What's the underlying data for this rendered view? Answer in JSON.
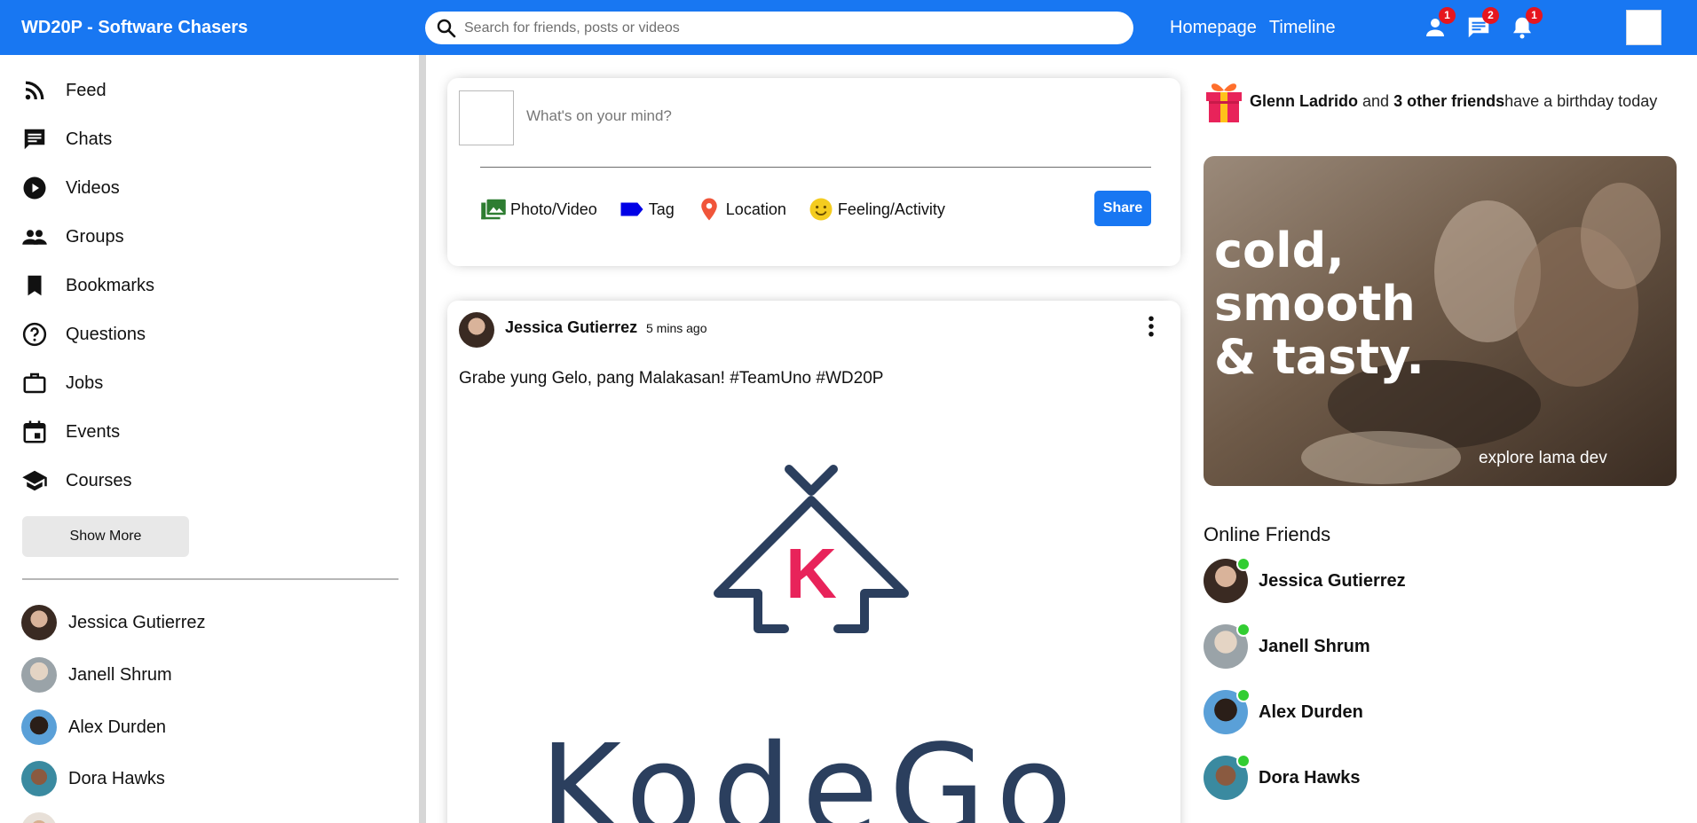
{
  "topbar": {
    "logo": "WD20P - Software Chasers",
    "search_placeholder": "Search for friends, posts or videos",
    "links": [
      "Homepage",
      "Timeline"
    ],
    "badges": {
      "friend_requests": "1",
      "messages": "2",
      "notifications": "1"
    },
    "accent_color": "#1877f2"
  },
  "sidebar": {
    "items": [
      {
        "label": "Feed",
        "icon": "rss-feed-icon"
      },
      {
        "label": "Chats",
        "icon": "chat-icon"
      },
      {
        "label": "Videos",
        "icon": "play-circle-icon"
      },
      {
        "label": "Groups",
        "icon": "group-icon"
      },
      {
        "label": "Bookmarks",
        "icon": "bookmark-icon"
      },
      {
        "label": "Questions",
        "icon": "help-outline-icon"
      },
      {
        "label": "Jobs",
        "icon": "work-outline-icon"
      },
      {
        "label": "Events",
        "icon": "event-icon"
      },
      {
        "label": "Courses",
        "icon": "school-icon"
      }
    ],
    "show_more": "Show More",
    "friends": [
      "Jessica Gutierrez",
      "Janell Shrum",
      "Alex Durden",
      "Dora Hawks"
    ]
  },
  "share": {
    "placeholder": "What's on your mind?",
    "options": [
      {
        "label": "Photo/Video",
        "icon": "perm-media-icon"
      },
      {
        "label": "Tag",
        "icon": "label-icon"
      },
      {
        "label": "Location",
        "icon": "room-icon"
      },
      {
        "label": "Feeling/Activity",
        "icon": "emoji-emotions-icon"
      }
    ],
    "button": "Share"
  },
  "post": {
    "username": "Jessica Gutierrez",
    "date": "5 mins ago",
    "text": "Grabe yung Gelo, pang Malakasan! #TeamUno #WD20P",
    "image_wordmark": "KodeGo",
    "image_monogram": "K"
  },
  "rightbar": {
    "birthday": {
      "friend": "Glenn Ladrido",
      "and": " and ",
      "others": "3 other friends",
      "suffix": "have a birthday today"
    },
    "ad": {
      "line1": "cold,",
      "line2": "smooth",
      "line3": "& tasty.",
      "tagline": "explore lama dev"
    },
    "online_title": "Online Friends",
    "online_friends": [
      "Jessica Gutierrez",
      "Janell Shrum",
      "Alex Durden",
      "Dora Hawks"
    ],
    "online_color": "#32cd32"
  }
}
